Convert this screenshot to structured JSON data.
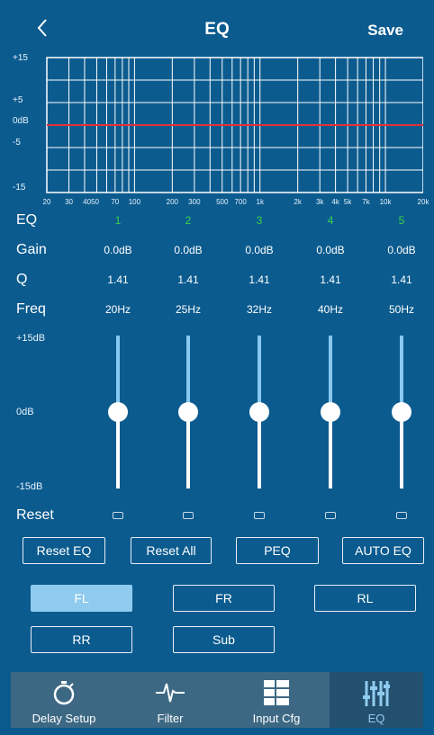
{
  "header": {
    "title": "EQ",
    "save_label": "Save",
    "back_icon": "chevron-left-icon"
  },
  "graph": {
    "y_labels": [
      "+15",
      "+5",
      "0dB",
      "-5",
      "-15"
    ],
    "x_labels": [
      "20",
      "30",
      "4050",
      "70",
      "100",
      "200",
      "300",
      "500",
      "700",
      "1k",
      "2k",
      "3k",
      "4k",
      "5k",
      "7k",
      "10k",
      "20k"
    ],
    "curve_color": "#e0303a",
    "gain_db": 0
  },
  "table": {
    "eq_label": "EQ",
    "gain_label": "Gain",
    "q_label": "Q",
    "freq_label": "Freq",
    "bands": [
      {
        "num": "1",
        "gain": "0.0dB",
        "q": "1.41",
        "freq": "20Hz",
        "level": 0
      },
      {
        "num": "2",
        "gain": "0.0dB",
        "q": "1.41",
        "freq": "25Hz",
        "level": 0
      },
      {
        "num": "3",
        "gain": "0.0dB",
        "q": "1.41",
        "freq": "32Hz",
        "level": 0
      },
      {
        "num": "4",
        "gain": "0.0dB",
        "q": "1.41",
        "freq": "40Hz",
        "level": 0
      },
      {
        "num": "5",
        "gain": "0.0dB",
        "q": "1.41",
        "freq": "50Hz",
        "level": 0
      }
    ]
  },
  "sliders": {
    "top_label": "+15dB",
    "mid_label": "0dB",
    "bottom_label": "-15dB",
    "range_db": [
      -15,
      15
    ]
  },
  "reset": {
    "label": "Reset"
  },
  "actions": {
    "reset_eq": "Reset EQ",
    "reset_all": "Reset All",
    "peq": "PEQ",
    "auto_eq": "AUTO EQ"
  },
  "channels": {
    "fl": "FL",
    "fr": "FR",
    "rl": "RL",
    "rr": "RR",
    "sub": "Sub",
    "selected": "FL"
  },
  "nav": {
    "delay": "Delay Setup",
    "filter": "Filter",
    "input": "Input Cfg",
    "eq": "EQ",
    "active": "EQ"
  },
  "colors": {
    "background": "#0b5b8f",
    "accent": "#8fcbef",
    "eq_number": "#3cd04a",
    "nav_bg": "#3d6883",
    "nav_active": "#24506f"
  }
}
